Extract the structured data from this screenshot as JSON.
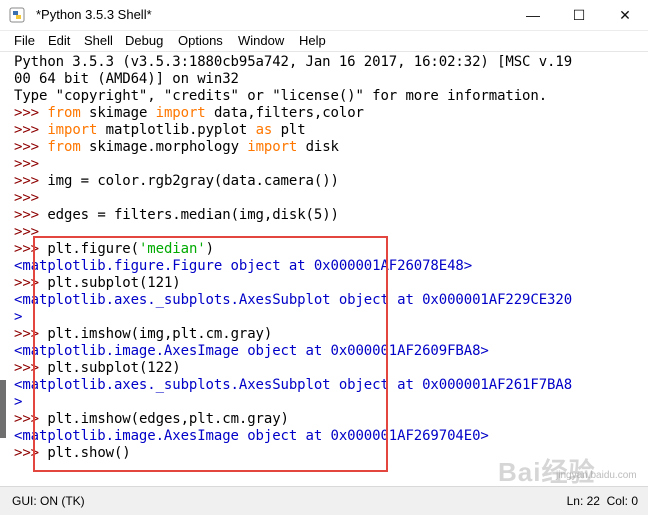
{
  "window": {
    "title": "*Python 3.5.3 Shell*",
    "controls": {
      "minimize": "—",
      "maximize": "☐",
      "close": "✕"
    }
  },
  "menu": [
    "File",
    "Edit",
    "Shell",
    "Debug",
    "Options",
    "Window",
    "Help"
  ],
  "prompt": ">>>",
  "shell": {
    "banner1": "Python 3.5.3 (v3.5.3:1880cb95a742, Jan 16 2017, 16:02:32) [MSC v.19",
    "banner2": "00 64 bit (AMD64)] on win32",
    "banner3": "Type \"copyright\", \"credits\" or \"license()\" for more information.",
    "l1": {
      "kw1": "from",
      "mid": " skimage ",
      "kw2": "import",
      "rest": " data,filters,color"
    },
    "l2": {
      "kw1": "import",
      "mid": " matplotlib.pyplot ",
      "kw2": "as",
      "rest": " plt"
    },
    "l3": {
      "kw1": "from",
      "mid": " skimage.morphology ",
      "kw2": "import",
      "rest": " disk"
    },
    "l5": "img = color.rgb2gray(data.camera())",
    "l7": "edges = filters.median(img,disk(5))",
    "l8": {
      "pre": "plt.figure(",
      "str": "'median'",
      "post": ")"
    },
    "out1": "<matplotlib.figure.Figure object at 0x000001AF26078E48>",
    "l9": "plt.subplot(121)",
    "out2a": "<matplotlib.axes._subplots.AxesSubplot object at 0x000001AF229CE320",
    "out2b": ">",
    "l10": "plt.imshow(img,plt.cm.gray)",
    "out3": "<matplotlib.image.AxesImage object at 0x000001AF2609FBA8>",
    "l11": "plt.subplot(122)",
    "out4a": "<matplotlib.axes._subplots.AxesSubplot object at 0x000001AF261F7BA8",
    "out4b": ">",
    "l12": "plt.imshow(edges,plt.cm.gray)",
    "out5": "<matplotlib.image.AxesImage object at 0x000001AF269704E0>",
    "l13": "plt.show()"
  },
  "status": {
    "left": "GUI: ON (TK)",
    "line": "Ln: 22",
    "col": "Col: 0"
  },
  "watermark": {
    "main": "Bai经验",
    "sub": "jingyan.baidu.com"
  },
  "colors": {
    "prompt": "#8e0000",
    "keyword": "#ff7700",
    "string": "#00aa00",
    "output": "#0000c8",
    "highlight": "#e2463f"
  }
}
